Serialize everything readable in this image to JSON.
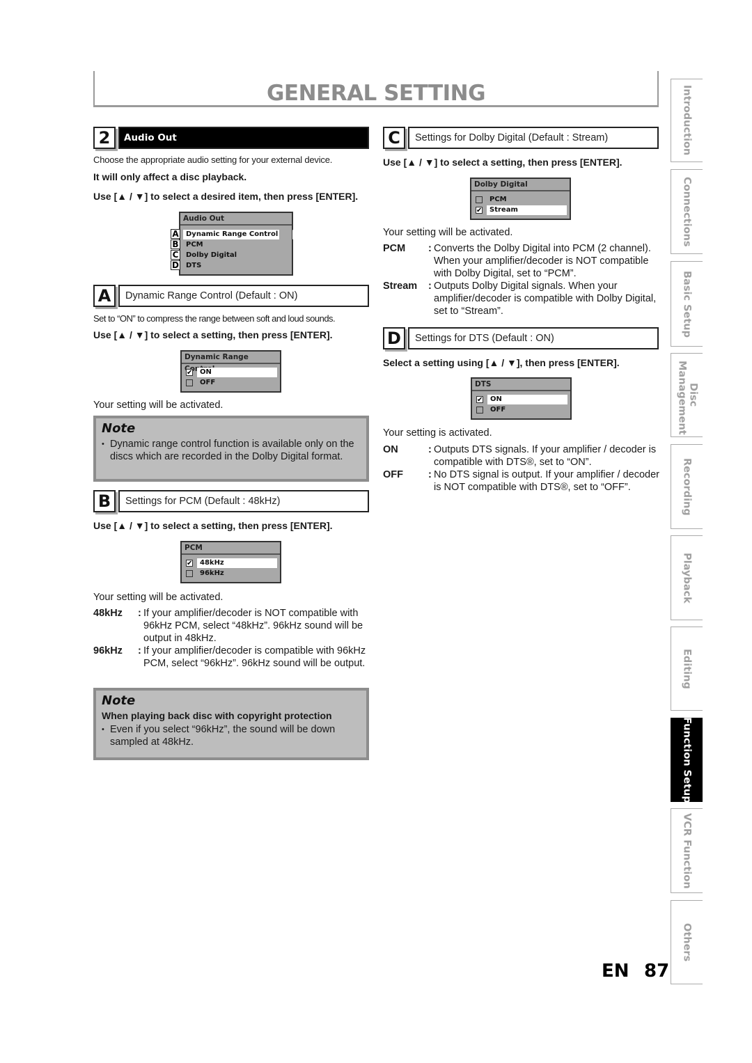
{
  "page_title": "GENERAL SETTING",
  "left": {
    "step": {
      "number": "2",
      "label": "Audio Out"
    },
    "intro": "Choose the appropriate audio setting for your external device.",
    "intro_bold": "It will only affect a disc playback.",
    "instruction": "Use [▲ / ▼] to select a desired item, then press [ENTER].",
    "audio_menu": {
      "header": "Audio Out",
      "items": [
        {
          "letter": "A",
          "label": "Dynamic Range Control",
          "highlighted": true
        },
        {
          "letter": "B",
          "label": "PCM",
          "highlighted": false
        },
        {
          "letter": "C",
          "label": "Dolby Digital",
          "highlighted": false
        },
        {
          "letter": "D",
          "label": "DTS",
          "highlighted": false
        }
      ]
    },
    "section_a": {
      "letter": "A",
      "label": "Dynamic Range Control (Default : ON)",
      "description": "Set to “ON” to compress the range between soft and loud sounds.",
      "instruction": "Use [▲ / ▼] to select a setting, then press [ENTER].",
      "menu": {
        "header": "Dynamic Range Control",
        "options": [
          {
            "label": "ON",
            "checked": true
          },
          {
            "label": "OFF",
            "checked": false
          }
        ]
      },
      "result": "Your setting will be activated."
    },
    "note_1": {
      "title": "Note",
      "items": [
        "Dynamic range control function is available only on the discs which are recorded in the Dolby Digital format."
      ]
    },
    "section_b": {
      "letter": "B",
      "label": "Settings for PCM (Default : 48kHz)",
      "instruction": "Use [▲ / ▼] to select a setting, then press [ENTER].",
      "menu": {
        "header": "PCM",
        "options": [
          {
            "label": "48kHz",
            "checked": true
          },
          {
            "label": "96kHz",
            "checked": false
          }
        ]
      },
      "result": "Your setting will be activated.",
      "definitions": [
        {
          "term": "48kHz",
          "desc": "If your amplifier/decoder is NOT compatible with 96kHz PCM, select “48kHz”. 96kHz sound will be output in 48kHz."
        },
        {
          "term": "96kHz",
          "desc": "If your amplifier/decoder is compatible with 96kHz PCM, select “96kHz”. 96kHz sound will be output."
        }
      ]
    },
    "note_2": {
      "title": "Note",
      "subtitle": "When playing back disc with copyright protection",
      "items": [
        "Even if you select “96kHz”, the sound will be down sampled at 48kHz."
      ]
    }
  },
  "right": {
    "section_c": {
      "letter": "C",
      "label": "Settings for Dolby Digital (Default : Stream)",
      "instruction": "Use [▲ / ▼] to select a setting, then press [ENTER].",
      "menu": {
        "header": "Dolby Digital",
        "options": [
          {
            "label": "PCM",
            "checked": false
          },
          {
            "label": "Stream",
            "checked": true
          }
        ]
      },
      "result": "Your setting will be activated.",
      "definitions": [
        {
          "term": "PCM",
          "desc": "Converts the Dolby Digital into PCM (2 channel). When your amplifier/decoder is NOT compatible with Dolby Digital, set to “PCM”."
        },
        {
          "term": "Stream",
          "desc": "Outputs Dolby Digital signals. When your amplifier/decoder is compatible with Dolby Digital, set to “Stream”."
        }
      ]
    },
    "section_d": {
      "letter": "D",
      "label": "Settings for DTS (Default : ON)",
      "instruction": "Select a setting using [▲ / ▼], then press [ENTER].",
      "menu": {
        "header": "DTS",
        "options": [
          {
            "label": "ON",
            "checked": true
          },
          {
            "label": "OFF",
            "checked": false
          }
        ]
      },
      "result": "Your setting is activated.",
      "definitions": [
        {
          "term": "ON",
          "desc": "Outputs DTS signals. If your amplifier / decoder is compatible with DTS®, set to “ON”."
        },
        {
          "term": "OFF",
          "desc": "No DTS signal is output. If your amplifier / decoder is NOT compatible with DTS®, set to “OFF”."
        }
      ]
    }
  },
  "sidebar": {
    "tabs": [
      {
        "label": "Introduction",
        "active": false
      },
      {
        "label": "Connections",
        "active": false
      },
      {
        "label": "Basic Setup",
        "active": false
      },
      {
        "label": "Disc Management",
        "active": false
      },
      {
        "label": "Recording",
        "active": false
      },
      {
        "label": "Playback",
        "active": false
      },
      {
        "label": "Editing",
        "active": false
      },
      {
        "label": "Function Setup",
        "active": true
      },
      {
        "label": "VCR Function",
        "active": false
      },
      {
        "label": "Others",
        "active": false
      }
    ]
  },
  "footer": {
    "language": "EN",
    "page_number": "87"
  },
  "check_glyph": "✔"
}
